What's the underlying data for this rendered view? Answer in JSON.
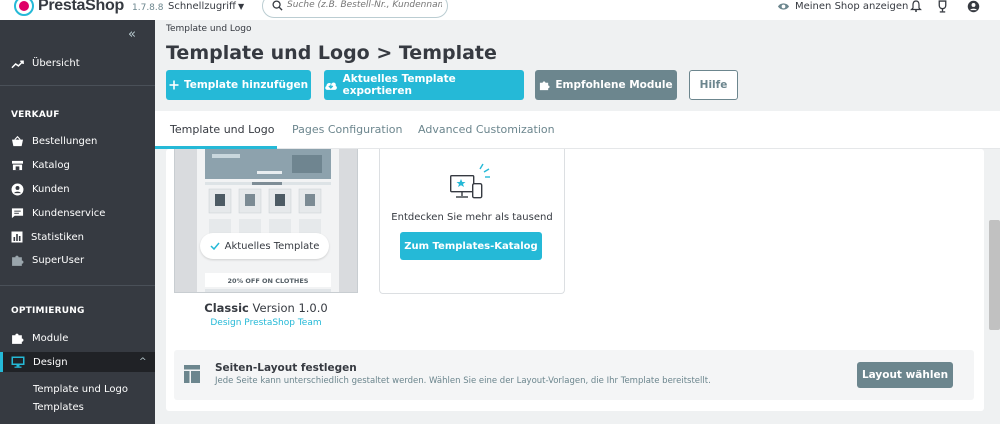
{
  "header": {
    "logo_text": "PrestaShop",
    "version": "1.7.8.8",
    "quick_access": "Schnellzugriff",
    "search_placeholder": "Suche (z.B. Bestell-Nr., Kundenname ...",
    "view_shop": "Meinen Shop anzeigen"
  },
  "sidebar": {
    "dashboard": "Übersicht",
    "section_sell": "VERKAUF",
    "sell_items": [
      "Bestellungen",
      "Katalog",
      "Kunden",
      "Kundenservice",
      "Statistiken",
      "SuperUser"
    ],
    "section_improve": "OPTIMIERUNG",
    "modules": "Module",
    "design": "Design",
    "design_sub": [
      "Template und Logo",
      "Templates"
    ]
  },
  "page": {
    "breadcrumb": "Template und Logo",
    "title": "Template und Logo > Template",
    "buttons": {
      "add_template": "Template hinzufügen",
      "export_template": "Aktuelles Template exportieren",
      "recommended_modules": "Empfohlene Module",
      "help": "Hilfe"
    },
    "tabs": [
      "Template und Logo",
      "Pages Configuration",
      "Advanced Customization"
    ],
    "active_tab": "Template und Logo"
  },
  "template": {
    "current_label": "Aktuelles Template",
    "name": "Classic",
    "version": "Version 1.0.0",
    "author": "Design PrestaShop Team",
    "preview_banner": "20% OFF ON CLOTHES"
  },
  "discover": {
    "text": "Entdecken Sie mehr als tausend",
    "button": "Zum Templates-Katalog"
  },
  "layout": {
    "title": "Seiten-Layout festlegen",
    "description": "Jede Seite kann unterschiedlich gestaltet werden. Wählen Sie eine der Layout-Vorlagen, die Ihr Template bereitstellt.",
    "button": "Layout wählen"
  },
  "colors": {
    "primary": "#25b9d7",
    "sidebar": "#363a41",
    "secondary": "#6c868e",
    "brand_pink": "#df0067"
  }
}
